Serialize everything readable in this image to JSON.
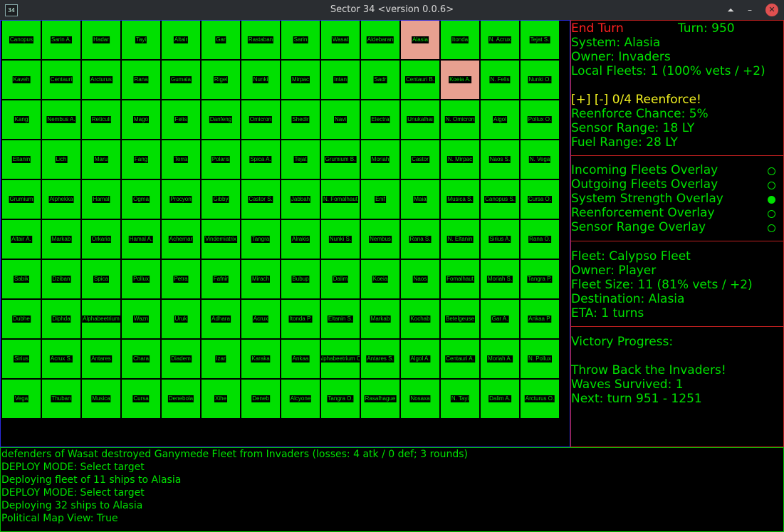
{
  "window": {
    "icon_label": "34",
    "title": "Sector 34    <version 0.0.6>",
    "buttons": [
      "⏶",
      "–",
      "✕"
    ]
  },
  "map": {
    "rows": [
      [
        "Canopus",
        "Sarin A.",
        "Hadar",
        "Tayi",
        "Altair",
        "Gar",
        "Rastaban",
        "Sarin",
        "Wasat",
        "Aldebaran",
        "Alasia",
        "Itonda",
        "N. Acrux",
        "Tejat S."
      ],
      [
        "Kaveh",
        "Centauri",
        "Arcturus",
        "Rana",
        "Gumala",
        "Rigel",
        "Nunki",
        "Mirpac",
        "Intan",
        "Sadr",
        "Centauri B.",
        "Koeia A.",
        "N. Felis",
        "Nunki O."
      ],
      [
        "Kang",
        "Nembus A.",
        "Reticuli",
        "Mago",
        "Felis",
        "Danfeng",
        "Omicron",
        "Shedir",
        "Navi",
        "Electra",
        "Unukalhai",
        "N. Omicron",
        "Algol",
        "Pollux O."
      ],
      [
        "Eltanin",
        "Lich",
        "Maru",
        "Fang",
        "Terra",
        "Polaris",
        "Spica A.",
        "Tejat",
        "Grumium B.",
        "Moriah",
        "Castor",
        "N. Mirpac",
        "Naos S.",
        "N. Vega"
      ],
      [
        "Grumium",
        "Alphekka",
        "Hamal",
        "Ogma",
        "Procyon",
        "Gibby",
        "Castor S.",
        "Jabbah",
        "N. Fomalhaut",
        "Enif",
        "Maia",
        "Musica S.",
        "Canopus S.",
        "Cursa O."
      ],
      [
        "Altair A.",
        "Markab",
        "Orkaria",
        "Hamal A.",
        "Achernar",
        "Vindemiatrix",
        "Tangra",
        "Alrakis",
        "Nunki S.",
        "Nembus",
        "Rana S.",
        "N. Eltanin",
        "Sirius A.",
        "Rana O."
      ],
      [
        "Sabik",
        "Dziban",
        "Spica",
        "Pollux",
        "Petra",
        "Fafnir",
        "Mirach",
        "Bubup",
        "Dalim",
        "Koeia",
        "Naos",
        "Fomalhaut",
        "Moriah S.",
        "Tangra P."
      ],
      [
        "Dubhe",
        "Diphda",
        "Alphabeetrium",
        "Wazn",
        "Uruk",
        "Adhara",
        "Acrux",
        "Itonda P.",
        "Eltanin S.",
        "Markab",
        "Kochab",
        "Betelgeuse",
        "Gar A.",
        "Ankaa P."
      ],
      [
        "Sirius",
        "Acrux S.",
        "Antares",
        "Chara",
        "Diadem",
        "Izar",
        "Karaka",
        "Ankaa",
        "Alphabeetrium C.",
        "Antares S.",
        "Algol A.",
        "Centauri A.",
        "Moriah A.",
        "N. Pollux"
      ],
      [
        "Vega",
        "Thuban",
        "Musica",
        "Cursa",
        "Denebola",
        "Xihe",
        "Deneb",
        "Alcyone",
        "Tangra O.",
        "Rasalhague",
        "Nosaxa",
        "N. Tayi",
        "Dalim A.",
        "Arcturus O."
      ]
    ],
    "enemy_cells": [
      [
        0,
        10
      ],
      [
        1,
        11
      ]
    ],
    "owned_color": "#00e000",
    "enemy_color": "#e8a090"
  },
  "side": {
    "end_turn": "End Turn",
    "turn": "Turn: 950",
    "system": "System: Alasia",
    "owner": "Owner: Invaders",
    "local_fleets": "Local Fleets: 1 (100% vets / +2)",
    "reenforce_line": "[+]  [-]   0/4 Reenforce!",
    "reenforce_chance": "Reenforce Chance: 5%",
    "sensor_range": "Sensor Range: 18 LY",
    "fuel_range": "Fuel Range: 28 LY",
    "overlays": [
      {
        "label": "Incoming Fleets Overlay",
        "on": false
      },
      {
        "label": "Outgoing Fleets Overlay",
        "on": false
      },
      {
        "label": "System Strength Overlay",
        "on": true
      },
      {
        "label": "Reenforcement Overlay",
        "on": false
      },
      {
        "label": "Sensor Range Overlay",
        "on": false
      }
    ],
    "fleet": {
      "name": "Fleet: Calypso Fleet",
      "owner": "Owner: Player",
      "size": "Fleet Size: 11 (81% vets / +2)",
      "destination": "Destination: Alasia",
      "eta": "ETA: 1 turns"
    },
    "victory": {
      "heading": "Victory Progress:",
      "goal": "Throw Back the Invaders!",
      "waves": "Waves Survived: 1",
      "next": "Next: turn 951 - 1251"
    }
  },
  "log": [
    "defenders of Wasat destroyed Ganymede Fleet from Invaders (losses: 4 atk / 0 def; 3 rounds)",
    "DEPLOY MODE: Select target",
    "Deploying fleet of 11 ships to Alasia",
    "DEPLOY MODE: Select target",
    "Deploying 32 ships to Alasia",
    "Political Map View: True"
  ]
}
